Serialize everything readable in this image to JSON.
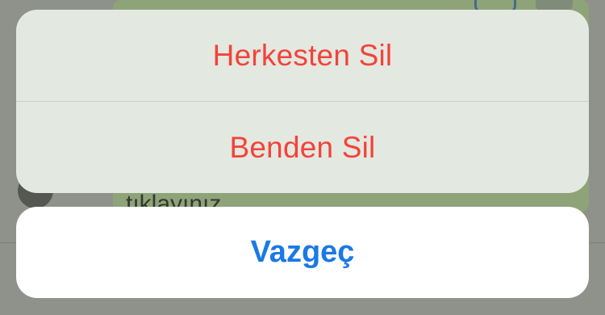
{
  "action_sheet": {
    "actions": [
      {
        "label": "Herkesten Sil",
        "color": "#f2433a"
      },
      {
        "label": "Benden Sil",
        "color": "#f2433a"
      }
    ],
    "cancel": {
      "label": "Vazgeç",
      "color": "#1a79e6"
    }
  },
  "background": {
    "message_text": "tıklayınız"
  }
}
